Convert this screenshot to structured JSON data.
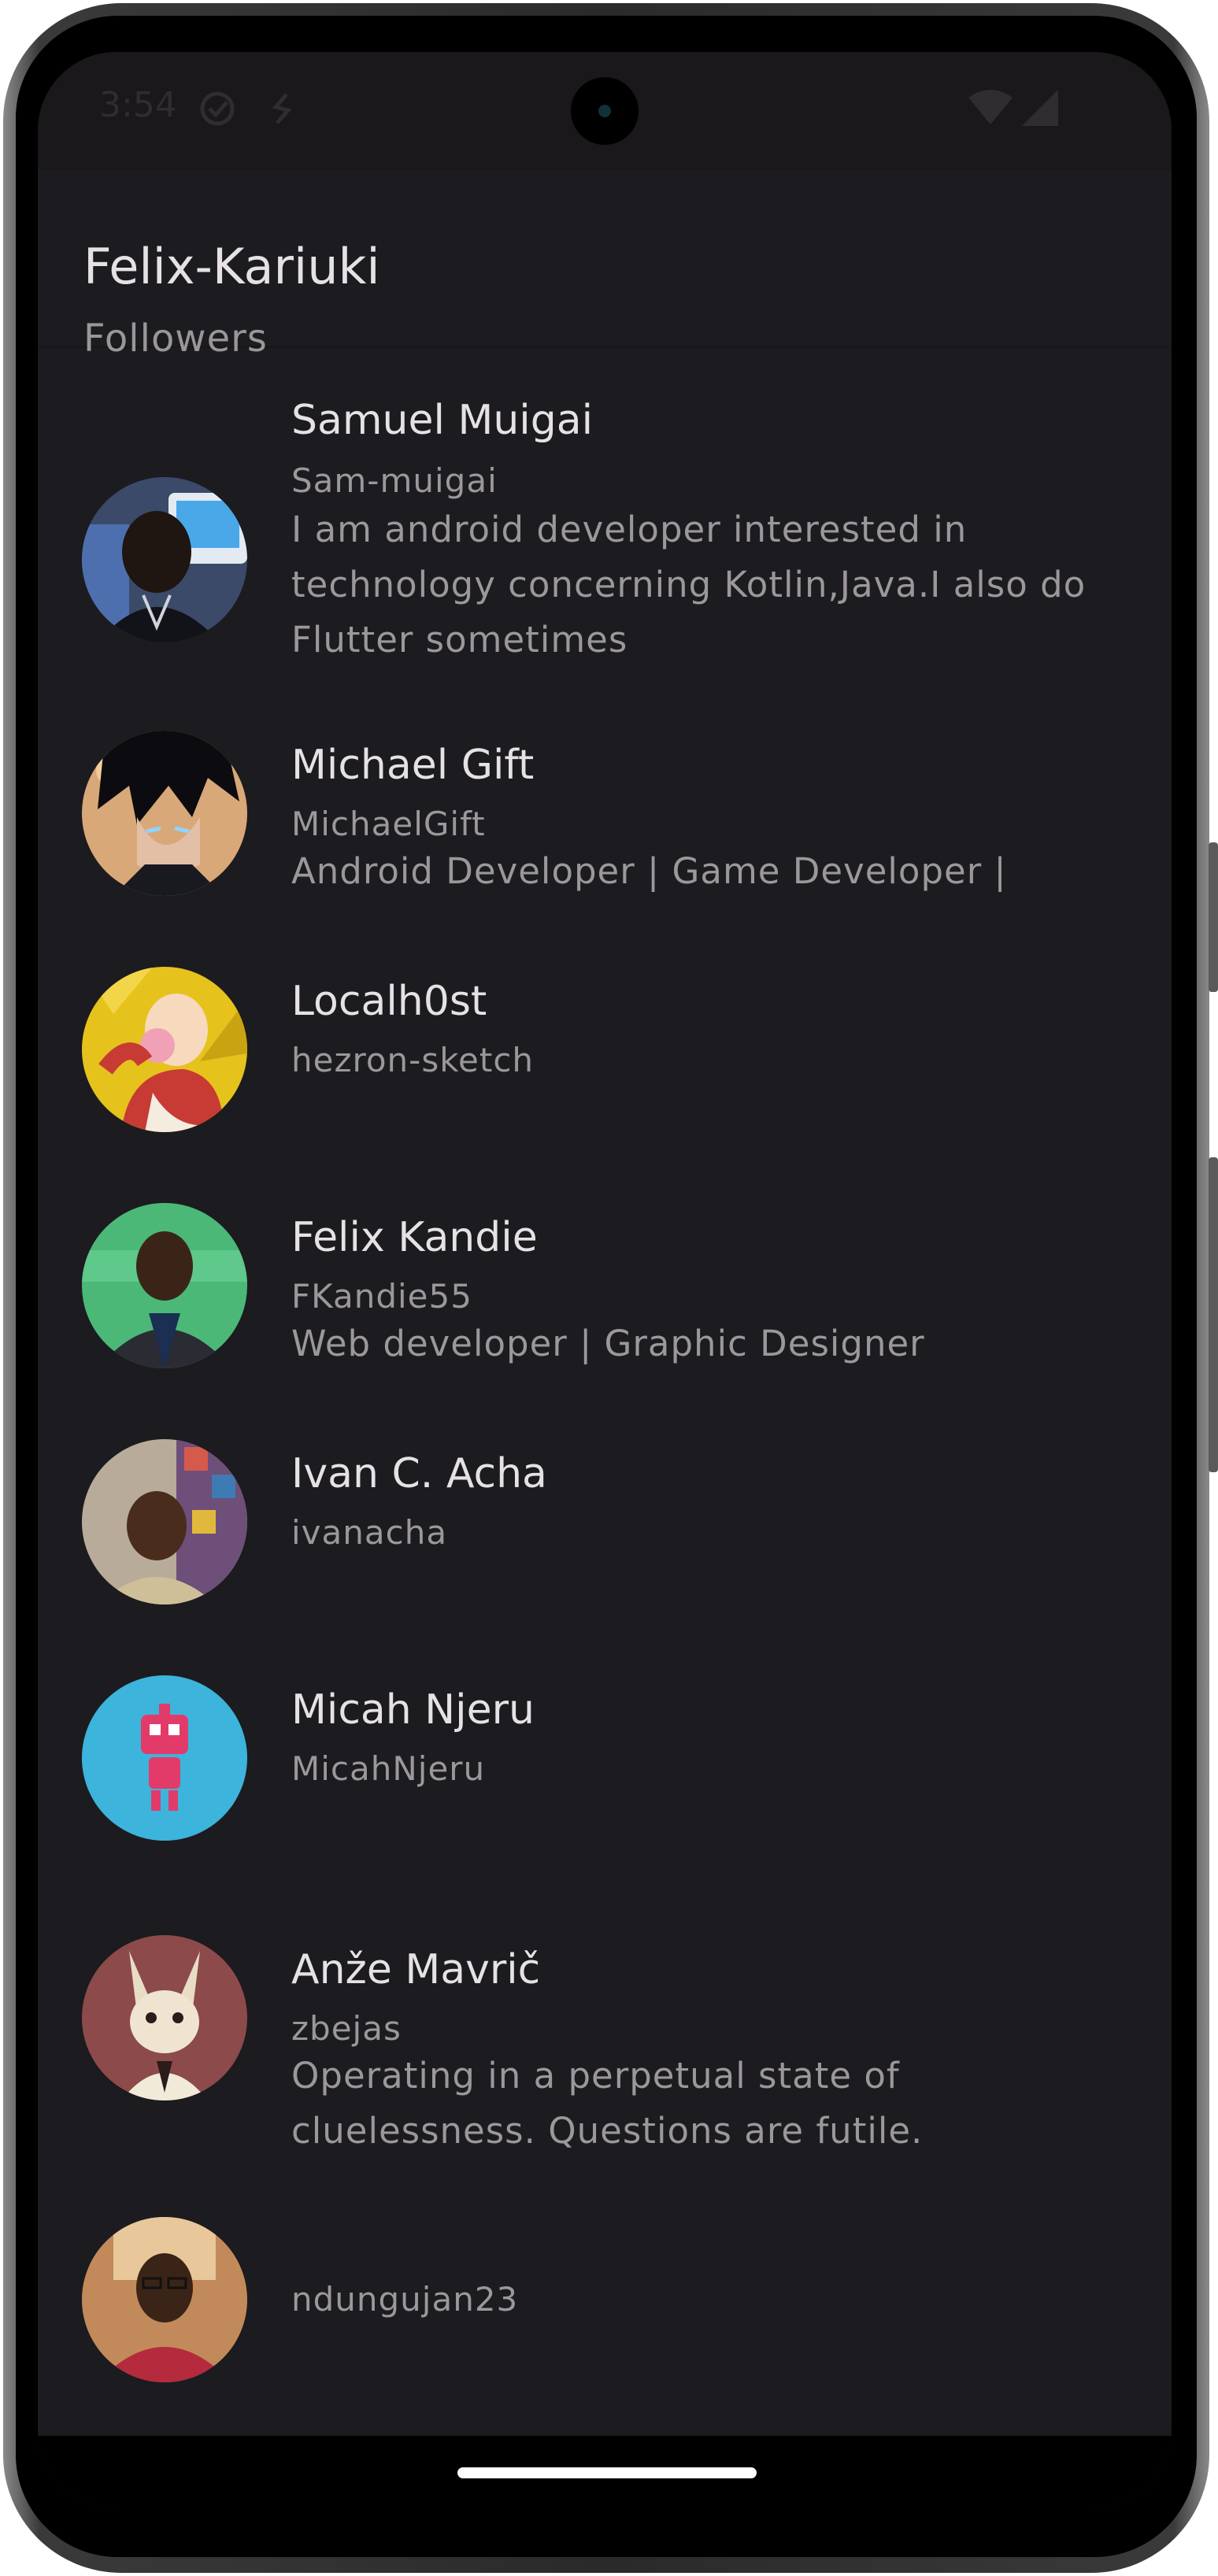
{
  "status_bar": {
    "time": "3:54"
  },
  "app_bar": {
    "title": "Felix-Kariuki",
    "subtitle": "Followers"
  },
  "followers": [
    {
      "name": "Samuel Muigai",
      "login": "Sam-muigai",
      "bio": "I am android developer interested in technology concerning Kotlin,Java.I also do Flutter sometimes"
    },
    {
      "name": "Michael Gift",
      "login": "MichaelGift",
      "bio": "Android Developer | Game Developer |"
    },
    {
      "name": "Localh0st",
      "login": "hezron-sketch",
      "bio": ""
    },
    {
      "name": "Felix Kandie",
      "login": "FKandie55",
      "bio": "Web developer | Graphic Designer"
    },
    {
      "name": "Ivan C. Acha",
      "login": "ivanacha",
      "bio": ""
    },
    {
      "name": "Micah Njeru",
      "login": "MicahNjeru",
      "bio": ""
    },
    {
      "name": "Anže Mavrič",
      "login": "zbejas",
      "bio": "Operating in a perpetual state of cluelessness. Questions are futile."
    },
    {
      "name": "",
      "login": "ndungujan23",
      "bio": ""
    }
  ],
  "colors": {
    "background": "#1c1b1f",
    "primary_text": "#e6e1e5",
    "secondary_text": "#9b979b"
  },
  "icons": {
    "status_check": "check-circle-icon",
    "status_sync": "sync-icon",
    "wifi": "wifi-icon",
    "signal": "signal-icon"
  }
}
